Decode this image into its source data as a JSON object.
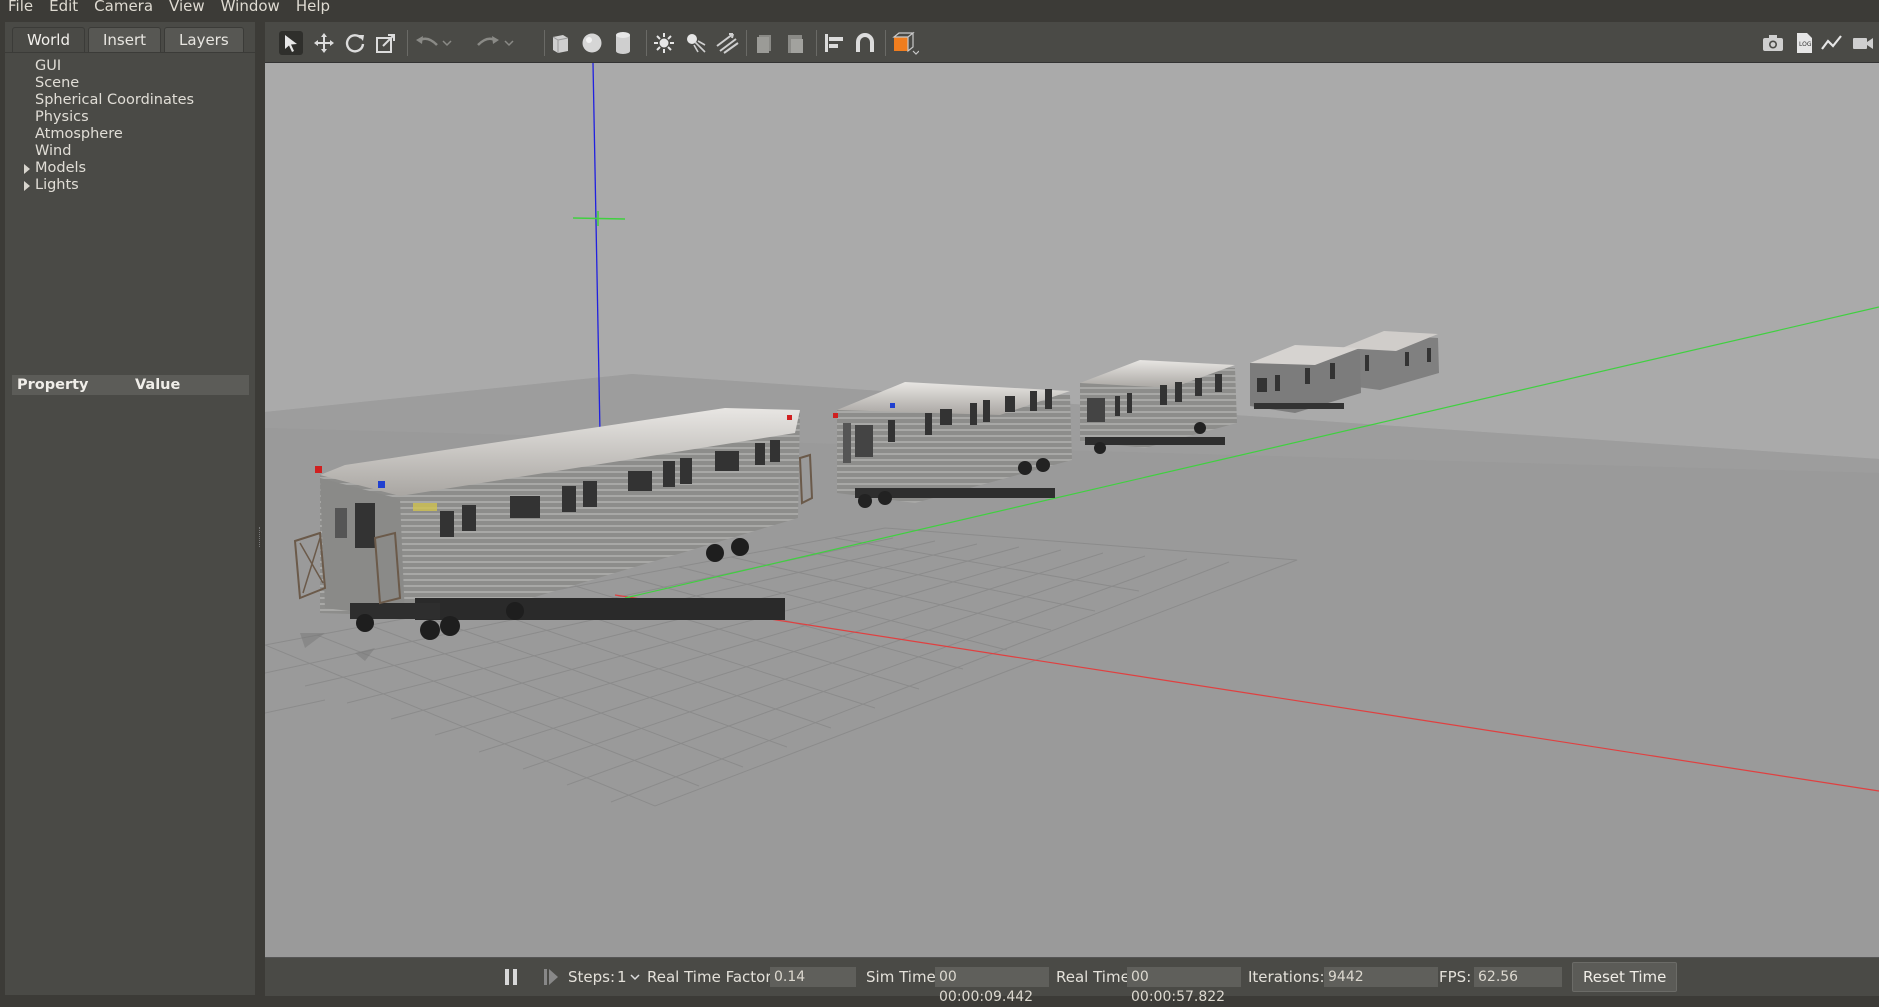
{
  "menu": [
    {
      "label": "File"
    },
    {
      "label": "Edit"
    },
    {
      "label": "Camera"
    },
    {
      "label": "View"
    },
    {
      "label": "Window"
    },
    {
      "label": "Help"
    }
  ],
  "tabs": [
    {
      "label": "World",
      "active": true
    },
    {
      "label": "Insert"
    },
    {
      "label": "Layers"
    }
  ],
  "tree": [
    {
      "label": "GUI"
    },
    {
      "label": "Scene"
    },
    {
      "label": "Spherical Coordinates"
    },
    {
      "label": "Physics"
    },
    {
      "label": "Atmosphere"
    },
    {
      "label": "Wind"
    },
    {
      "label": "Models",
      "expandable": true
    },
    {
      "label": "Lights",
      "expandable": true
    }
  ],
  "properties": {
    "col_property": "Property",
    "col_value": "Value"
  },
  "toolbar": {
    "tools": [
      "select-arrow-icon",
      "translate-icon",
      "rotate-icon",
      "scale-icon",
      "undo-icon",
      "undo-history-icon",
      "redo-icon",
      "redo-history-icon",
      "box-icon",
      "sphere-icon",
      "cylinder-icon",
      "point-light-icon",
      "spot-light-icon",
      "directional-light-icon",
      "copy-icon",
      "paste-icon",
      "align-icon",
      "snap-icon",
      "view-angle-icon"
    ],
    "right_tools": [
      "screenshot-icon",
      "log-icon",
      "plot-icon",
      "video-record-icon"
    ]
  },
  "status": {
    "steps_label": "Steps:",
    "steps_value": "1",
    "rtf_label": "Real Time Factor:",
    "rtf_value": "0.14",
    "sim_label": "Sim Time:",
    "sim_value": "00 00:00:09.442",
    "real_label": "Real Time:",
    "real_value": "00 00:00:57.822",
    "iter_label": "Iterations:",
    "iter_value": "9442",
    "fps_label": "FPS:",
    "fps_value": "62.56",
    "reset_label": "Reset Time"
  },
  "colors": {
    "axis_x": "#e04040",
    "axis_y": "#40d040",
    "axis_z": "#2020e0",
    "sky": "#a9a9a9",
    "ground": "#999999"
  }
}
